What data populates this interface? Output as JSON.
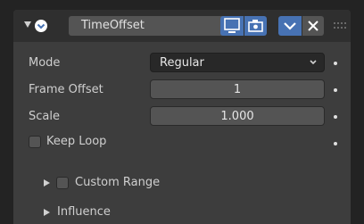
{
  "header": {
    "modifier_name": "TimeOffset",
    "chevron_icon": "chevron-down-icon",
    "modifier_icon": "time-offset-icon",
    "visibility_viewport_icon": "monitor-icon",
    "visibility_render_icon": "camera-icon",
    "apply_icon": "chevron-down-icon",
    "delete_icon": "close-icon",
    "drag_icon": "grip-icon"
  },
  "properties": {
    "mode": {
      "label": "Mode",
      "value": "Regular"
    },
    "frame_offset": {
      "label": "Frame Offset",
      "value": "1"
    },
    "scale": {
      "label": "Scale",
      "value": "1.000"
    },
    "keep_loop": {
      "label": "Keep Loop",
      "checked": false
    }
  },
  "subpanels": {
    "custom_range": {
      "label": "Custom Range",
      "checked": false,
      "expanded": false
    },
    "influence": {
      "label": "Influence",
      "expanded": false
    }
  },
  "colors": {
    "accent": "#4772b3",
    "panel_bg": "#3d3d3d",
    "header_bg": "#2f2f2f",
    "field_bg": "#545454",
    "dropdown_bg": "#282828"
  }
}
